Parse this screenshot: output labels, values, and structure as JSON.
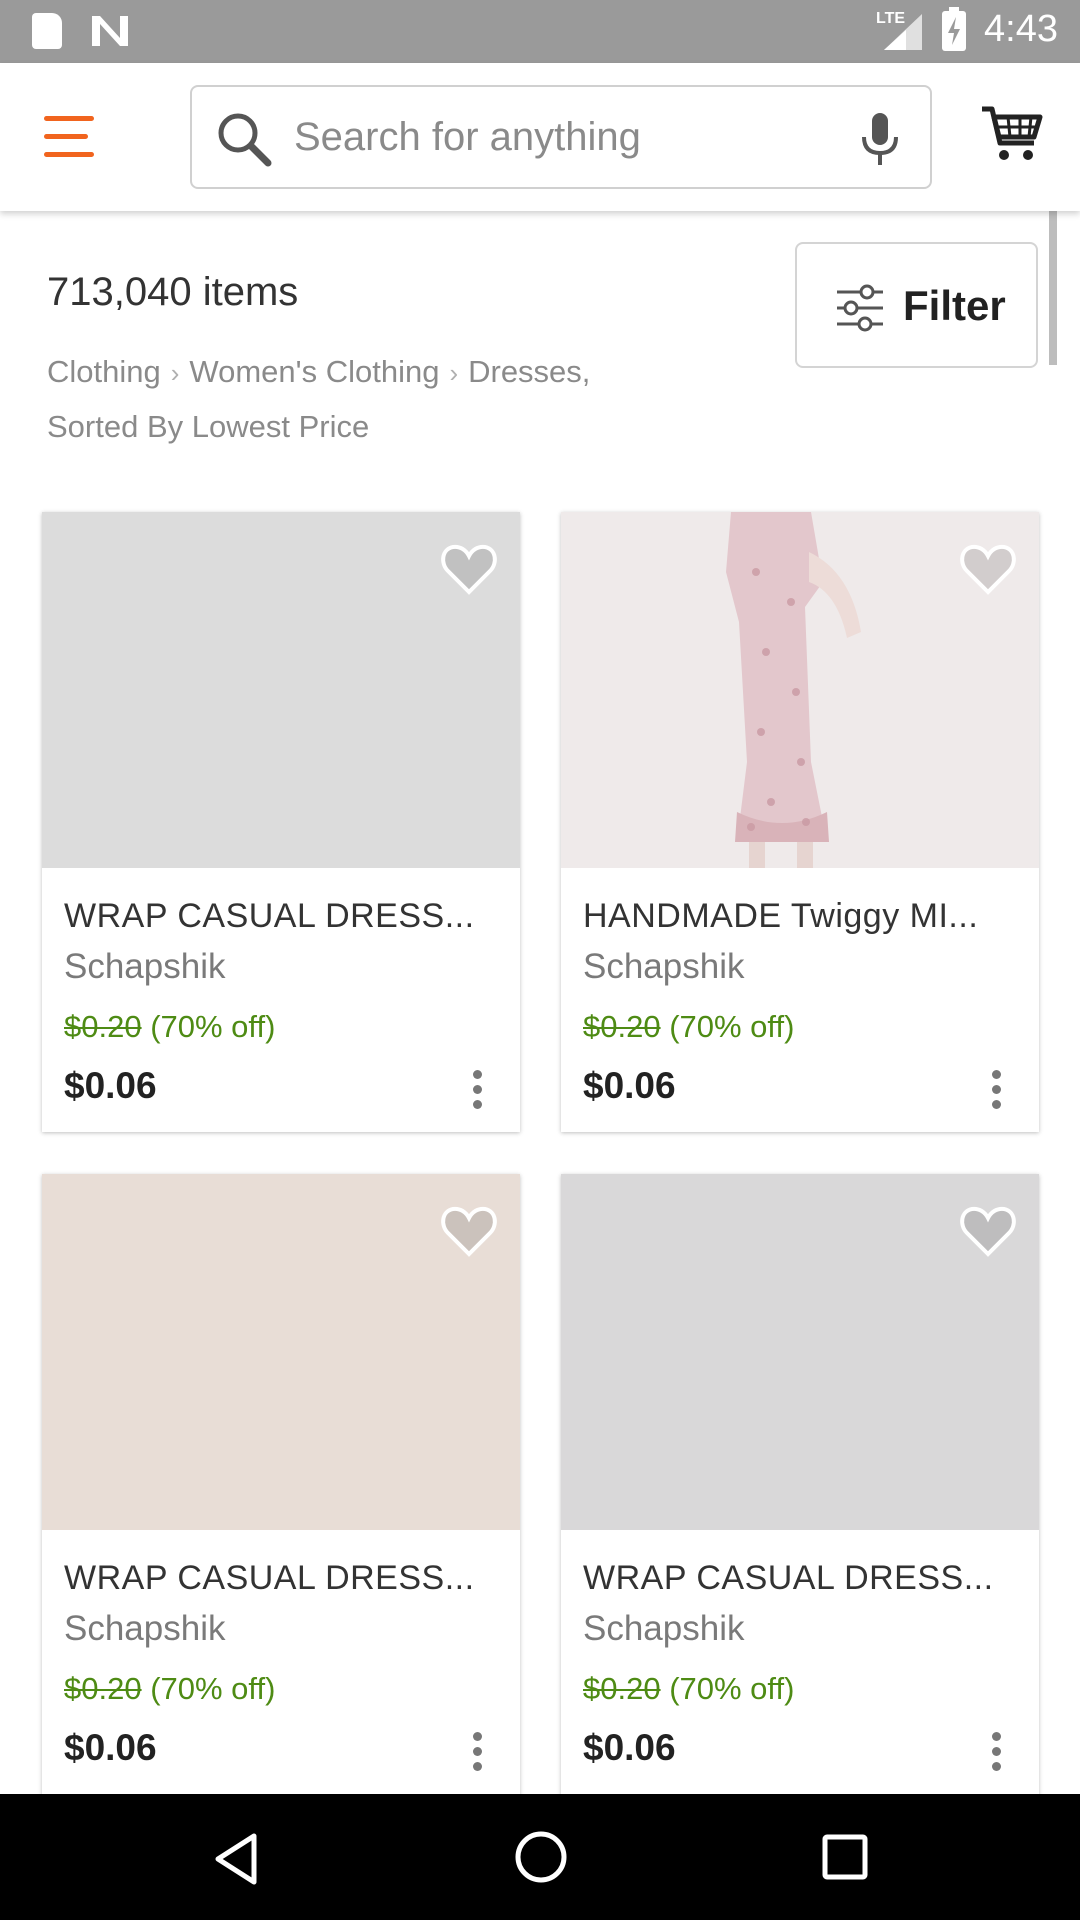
{
  "status_bar": {
    "time": "4:43",
    "network": "LTE",
    "icons": [
      "sd-card-icon",
      "n-icon",
      "signal-icon",
      "battery-charging-icon"
    ]
  },
  "header": {
    "menu_icon": "menu-icon",
    "search": {
      "placeholder": "Search for anything",
      "value": ""
    },
    "mic_icon": "mic-icon",
    "cart_icon": "cart-icon"
  },
  "results": {
    "count_text": "713,040 items",
    "breadcrumb": [
      "Clothing",
      "Women's Clothing",
      "Dresses,"
    ],
    "sort_text": "Sorted By Lowest Price",
    "filter_label": "Filter"
  },
  "listings": [
    {
      "title": "WRAP CASUAL DRESS...",
      "shop": "Schapshik",
      "original_price": "$0.20",
      "discount": "(70% off)",
      "price": "$0.06"
    },
    {
      "title": "HANDMADE Twiggy MI...",
      "shop": "Schapshik",
      "original_price": "$0.20",
      "discount": "(70% off)",
      "price": "$0.06"
    },
    {
      "title": "WRAP CASUAL DRESS...",
      "shop": "Schapshik",
      "original_price": "$0.20",
      "discount": "(70% off)",
      "price": "$0.06"
    },
    {
      "title": "WRAP CASUAL DRESS...",
      "shop": "Schapshik",
      "original_price": "$0.20",
      "discount": "(70% off)",
      "price": "$0.06"
    }
  ],
  "colors": {
    "accent": "#f1641e",
    "sale_green": "#4e8b14",
    "status_bar": "#9a9a9a"
  }
}
